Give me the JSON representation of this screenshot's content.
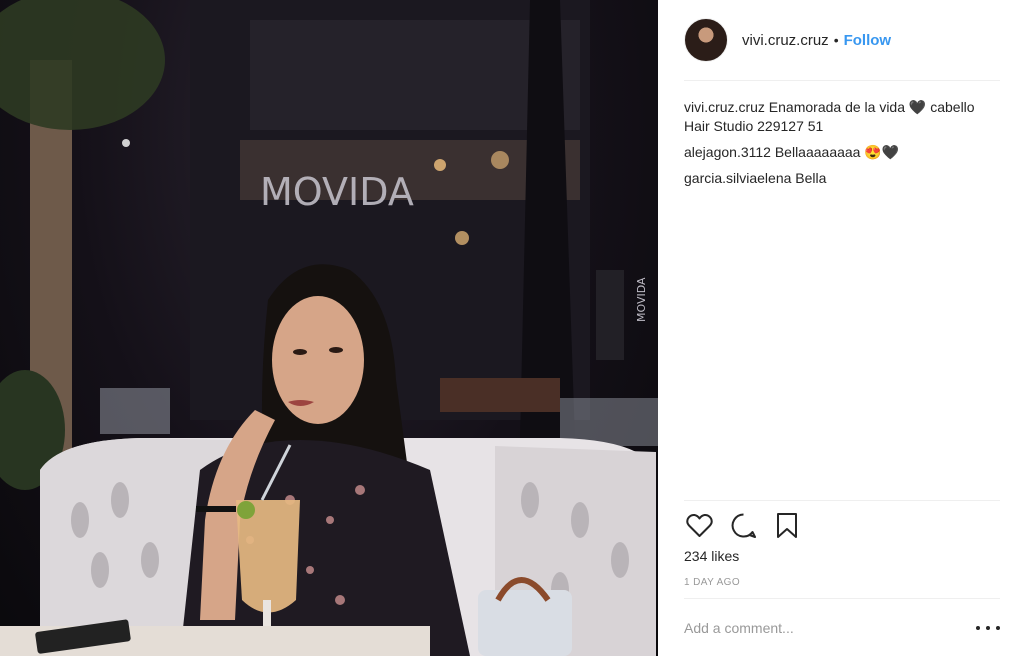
{
  "post": {
    "author": "vivi.cruz.cruz",
    "separator": "•",
    "follow_label": "Follow"
  },
  "comments": [
    {
      "user": "vivi.cruz.cruz",
      "text": "Enamorada de la vida 🖤 cabello Hair Studio 229127 51"
    },
    {
      "user": "alejagon.3112",
      "text": "Bellaaaaaaaa 😍🖤"
    },
    {
      "user": "garcia.silviaelena",
      "text": "Bella"
    }
  ],
  "likes_label": "234 likes",
  "date_label": "1 DAY AGO",
  "add_comment": {
    "placeholder": "Add a comment..."
  },
  "photo": {
    "sign_text": "MOVIDA",
    "side_sign_text": "MOVIDA"
  },
  "colors": {
    "link": "#3897f0",
    "text": "#262626",
    "muted": "#999999",
    "divider": "#efefef"
  },
  "icons": [
    "heart-icon",
    "comment-icon",
    "bookmark-icon",
    "more-options-icon"
  ]
}
